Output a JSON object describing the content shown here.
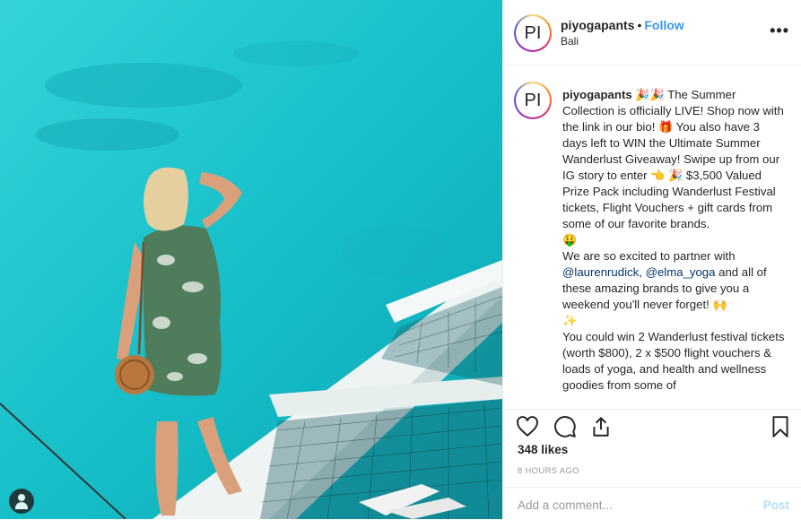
{
  "post": {
    "username": "piyogapants",
    "avatar_text": "PI",
    "separator": "•",
    "follow_label": "Follow",
    "location": "Bali",
    "more_label": "•••"
  },
  "caption": {
    "username": "piyogapants",
    "part1": " The Summer Collection is officially LIVE! Shop now with the link in our bio! ",
    "part2": " You also have 3 days left to WIN the Ultimate Summer Wanderlust Giveaway! Swipe up from our IG story to enter ",
    "part3": " $3,500 Valued Prize Pack including Wanderlust Festival tickets, Flight Vouchers + gift cards from some of our favorite brands.",
    "part4": "We are so excited to partner with ",
    "mention1": "@laurenrudick",
    "comma": ", ",
    "mention2": "@elma_yoga",
    "part5": " and all of these amazing brands to give you a weekend you'll never forget! ",
    "part6": "You could win 2 Wanderlust festival tickets (worth $800), 2 x $500 flight vouchers & loads of yoga, and health and wellness goodies from some of"
  },
  "icons": {
    "party": "party-popper-icon",
    "gift": "gift-icon",
    "point": "pointing-hand-icon",
    "money": "money-face-icon",
    "hands": "raised-hands-icon",
    "sparkle": "sparkle-icon"
  },
  "stats": {
    "likes": "348 likes",
    "time": "8 HOURS AGO"
  },
  "comment": {
    "placeholder": "Add a comment...",
    "post_label": "Post"
  }
}
